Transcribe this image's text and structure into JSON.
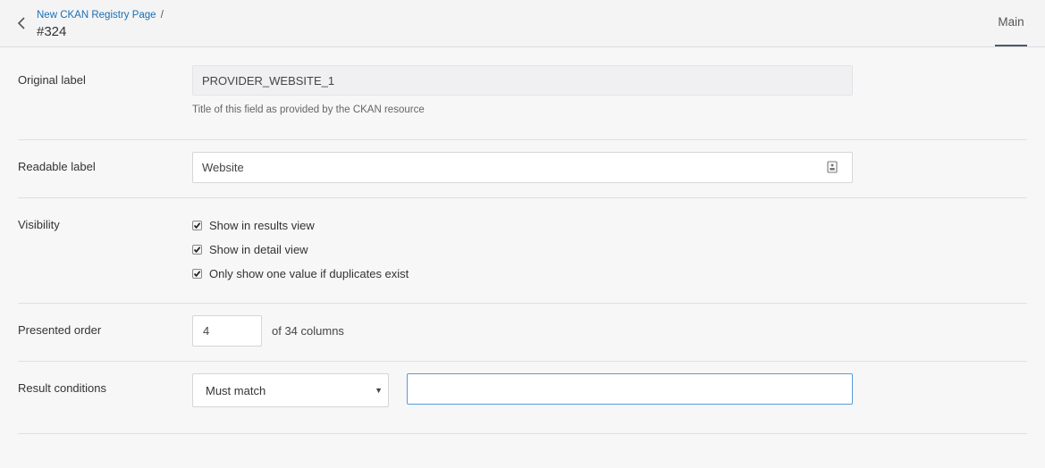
{
  "header": {
    "breadcrumb": "New CKAN Registry Page",
    "breadcrumb_separator": "/",
    "title": "#324",
    "tabs": [
      {
        "label": "Main"
      }
    ]
  },
  "form": {
    "original_label": {
      "label": "Original label",
      "value": "PROVIDER_WEBSITE_1",
      "help": "Title of this field as provided by the CKAN resource"
    },
    "readable_label": {
      "label": "Readable label",
      "value": "Website"
    },
    "visibility": {
      "label": "Visibility",
      "options": [
        {
          "label": "Show in results view",
          "checked": true
        },
        {
          "label": "Show in detail view",
          "checked": true
        },
        {
          "label": "Only show one value if duplicates exist",
          "checked": true
        }
      ]
    },
    "presented_order": {
      "label": "Presented order",
      "value": "4",
      "suffix": "of 34 columns"
    },
    "result_conditions": {
      "label": "Result conditions",
      "selected": "Must match",
      "value": ""
    }
  },
  "colors": {
    "link": "#1a6fb5",
    "focus_border": "#5a9bd5",
    "tab_underline": "#4a5a6c"
  }
}
